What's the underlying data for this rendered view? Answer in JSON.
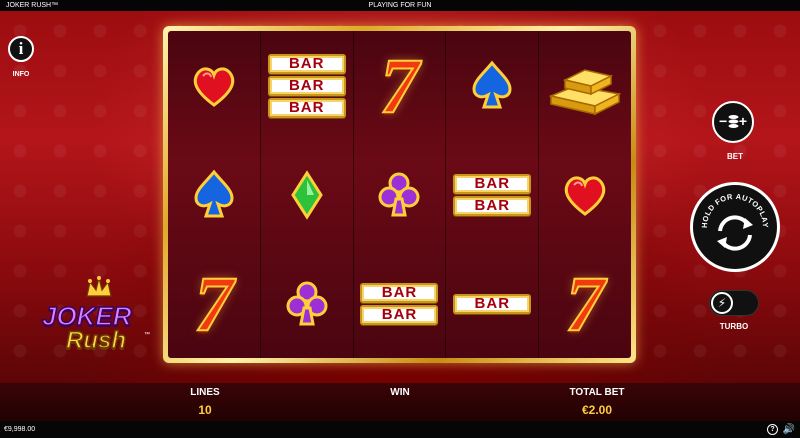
{
  "topbar": {
    "title": "JOKER RUSH™",
    "mode": "PLAYING FOR FUN"
  },
  "info": {
    "label": "INFO",
    "icon": "info-icon"
  },
  "logo": {
    "line1": "JOKER",
    "line2": "Rush",
    "tm": "™"
  },
  "reels": [
    [
      "heart",
      "spade-blue",
      "seven"
    ],
    [
      "bar3",
      "diamond-green",
      "club-purple"
    ],
    [
      "seven",
      "club-purple",
      "bar2"
    ],
    [
      "spade-blue",
      "bar2",
      "bar1"
    ],
    [
      "gold-bars",
      "heart",
      "seven"
    ]
  ],
  "symbols": {
    "bar": "BAR",
    "seven": "7"
  },
  "bet": {
    "label": "BET",
    "minus": "−",
    "plus": "+"
  },
  "spin": {
    "autoplay_text": "HOLD FOR AUTOPLAY"
  },
  "turbo": {
    "label": "TURBO",
    "state": "off"
  },
  "stats": {
    "lines_label": "LINES",
    "lines_value": "10",
    "win_label": "WIN",
    "win_value": "",
    "total_label": "TOTAL BET",
    "total_value": "€2.00"
  },
  "status": {
    "balance": "€9,998.00",
    "help": "?",
    "sound": "🔊"
  },
  "colors": {
    "accent": "#ffcf3a",
    "background": "#b3151a",
    "frame": "#e0a928"
  }
}
